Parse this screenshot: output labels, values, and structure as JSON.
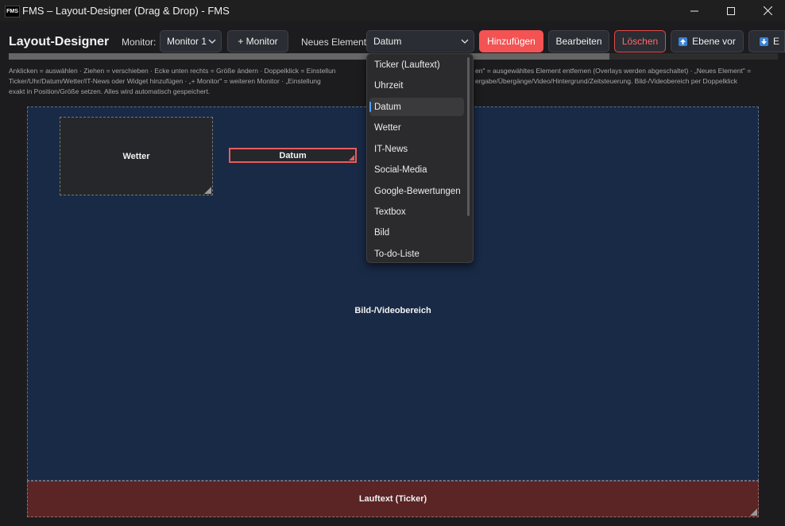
{
  "window": {
    "icon_label": "FMS",
    "title": "FMS – Layout-Designer (Drag & Drop) - FMS"
  },
  "toolbar": {
    "heading": "Layout-Designer",
    "monitor_label": "Monitor:",
    "monitor_value": "Monitor 1",
    "add_monitor_label": "+ Monitor",
    "new_element_label": "Neues Element:",
    "new_element_value": "Datum",
    "add_label": "Hinzufügen",
    "edit_label": "Bearbeiten",
    "delete_label": "Löschen",
    "layer_up_label": "Ebene vor",
    "layer_down_label": "E"
  },
  "hint": {
    "line1": "Anklicken = auswählen · Ziehen = verschieben · Ecke unten rechts = Größe ändern · Doppelklick = Einstellun",
    "line1b": "en\" = ausgewähltes Element entfernen (Overlays werden abgeschaltet) · „Neues Element\" =",
    "line2": "Ticker/Uhr/Datum/Wetter/IT-News oder Widget hinzufügen · „+ Monitor\" = weiteren Monitor · „Einstellung",
    "line2b": "ergabe/Übergänge/Video/Hintergrund/Zeitsteuerung. Bild-/Videobereich per Doppelklick",
    "line3": "exakt in Position/Größe setzen. Alles wird automatisch gespeichert."
  },
  "canvas": {
    "media_label": "Bild-/Videobereich",
    "weather_label": "Wetter",
    "date_label": "Datum",
    "ticker_label": "Lauftext (Ticker)"
  },
  "dropdown": {
    "items": [
      "Ticker (Lauftext)",
      "Uhrzeit",
      "Datum",
      "Wetter",
      "IT-News",
      "Social-Media",
      "Google-Bewertungen",
      "Textbox",
      "Bild",
      "To-do-Liste"
    ],
    "selected": "Datum"
  },
  "colors": {
    "accent_red": "#f35353",
    "canvas_blue": "#192a46",
    "ticker_red": "#5b2425",
    "selection_blue": "#4ea1ff"
  }
}
